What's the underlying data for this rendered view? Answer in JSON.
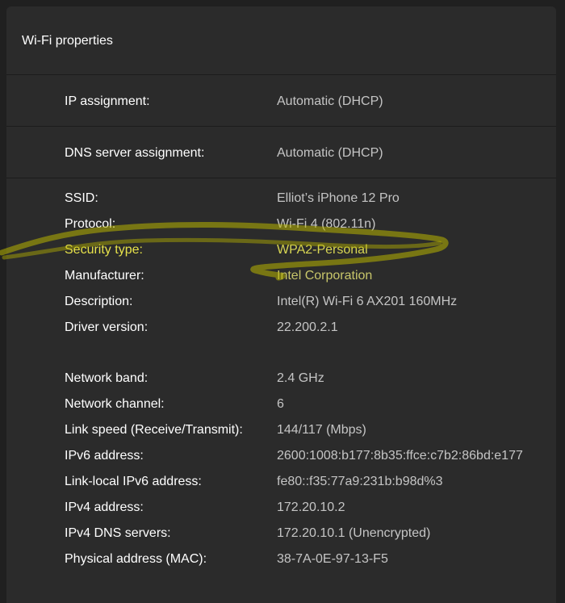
{
  "header": {
    "title": "Wi-Fi properties"
  },
  "ip_assignment": {
    "label": "IP assignment:",
    "value": "Automatic (DHCP)"
  },
  "dns_assignment": {
    "label": "DNS server assignment:",
    "value": "Automatic (DHCP)"
  },
  "properties": [
    {
      "label": "SSID:",
      "value": "Elliot’s iPhone 12 Pro"
    },
    {
      "label": "Protocol:",
      "value": "Wi-Fi 4 (802.11n)"
    },
    {
      "label": "Security type:",
      "value": "WPA2-Personal"
    },
    {
      "label": "Manufacturer:",
      "value": "Intel Corporation"
    },
    {
      "label": "Description:",
      "value": "Intel(R) Wi-Fi 6 AX201 160MHz"
    },
    {
      "label": "Driver version:",
      "value": "22.200.2.1"
    },
    {
      "label": "Network band:",
      "value": "2.4 GHz"
    },
    {
      "label": "Network channel:",
      "value": "6"
    },
    {
      "label": "Link speed (Receive/Transmit):",
      "value": "144/117 (Mbps)"
    },
    {
      "label": "IPv6 address:",
      "value": "2600:1008:b177:8b35:ffce:c7b2:86bd:e177"
    },
    {
      "label": "Link-local IPv6 address:",
      "value": "fe80::f35:77a9:231b:b98d%3"
    },
    {
      "label": "IPv4 address:",
      "value": "172.20.10.2"
    },
    {
      "label": "IPv4 DNS servers:",
      "value": "172.20.10.1 (Unencrypted)"
    },
    {
      "label": "Physical address (MAC):",
      "value": "38-7A-0E-97-13-F5"
    }
  ],
  "colors": {
    "background": "#202020",
    "panel": "#2b2b2b",
    "label_text": "#ffffff",
    "value_text": "#c5c5c5",
    "highlight_marker": "#c8c400"
  }
}
